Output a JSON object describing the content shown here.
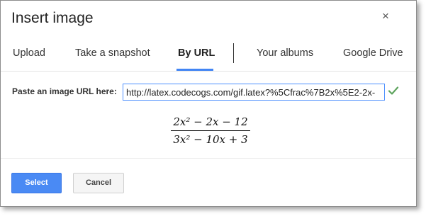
{
  "dialog": {
    "title": "Insert image",
    "close_label": "×"
  },
  "tabs": [
    {
      "label": "Upload",
      "active": false
    },
    {
      "label": "Take a snapshot",
      "active": false
    },
    {
      "label": "By URL",
      "active": true
    },
    {
      "label": "Your albums",
      "active": false
    },
    {
      "label": "Google Drive",
      "active": false
    }
  ],
  "url_form": {
    "label": "Paste an image URL here:",
    "value": "http://latex.codecogs.com/gif.latex?%5Cfrac%7B2x%5E2-2x-"
  },
  "preview": {
    "numerator": "2x² − 2x − 12",
    "denominator": "3x² − 10x + 3"
  },
  "footer": {
    "select_label": "Select",
    "cancel_label": "Cancel"
  },
  "colors": {
    "accent": "#4285f4",
    "select_button": "#4a8af4",
    "check_icon": "#5ea45e"
  }
}
